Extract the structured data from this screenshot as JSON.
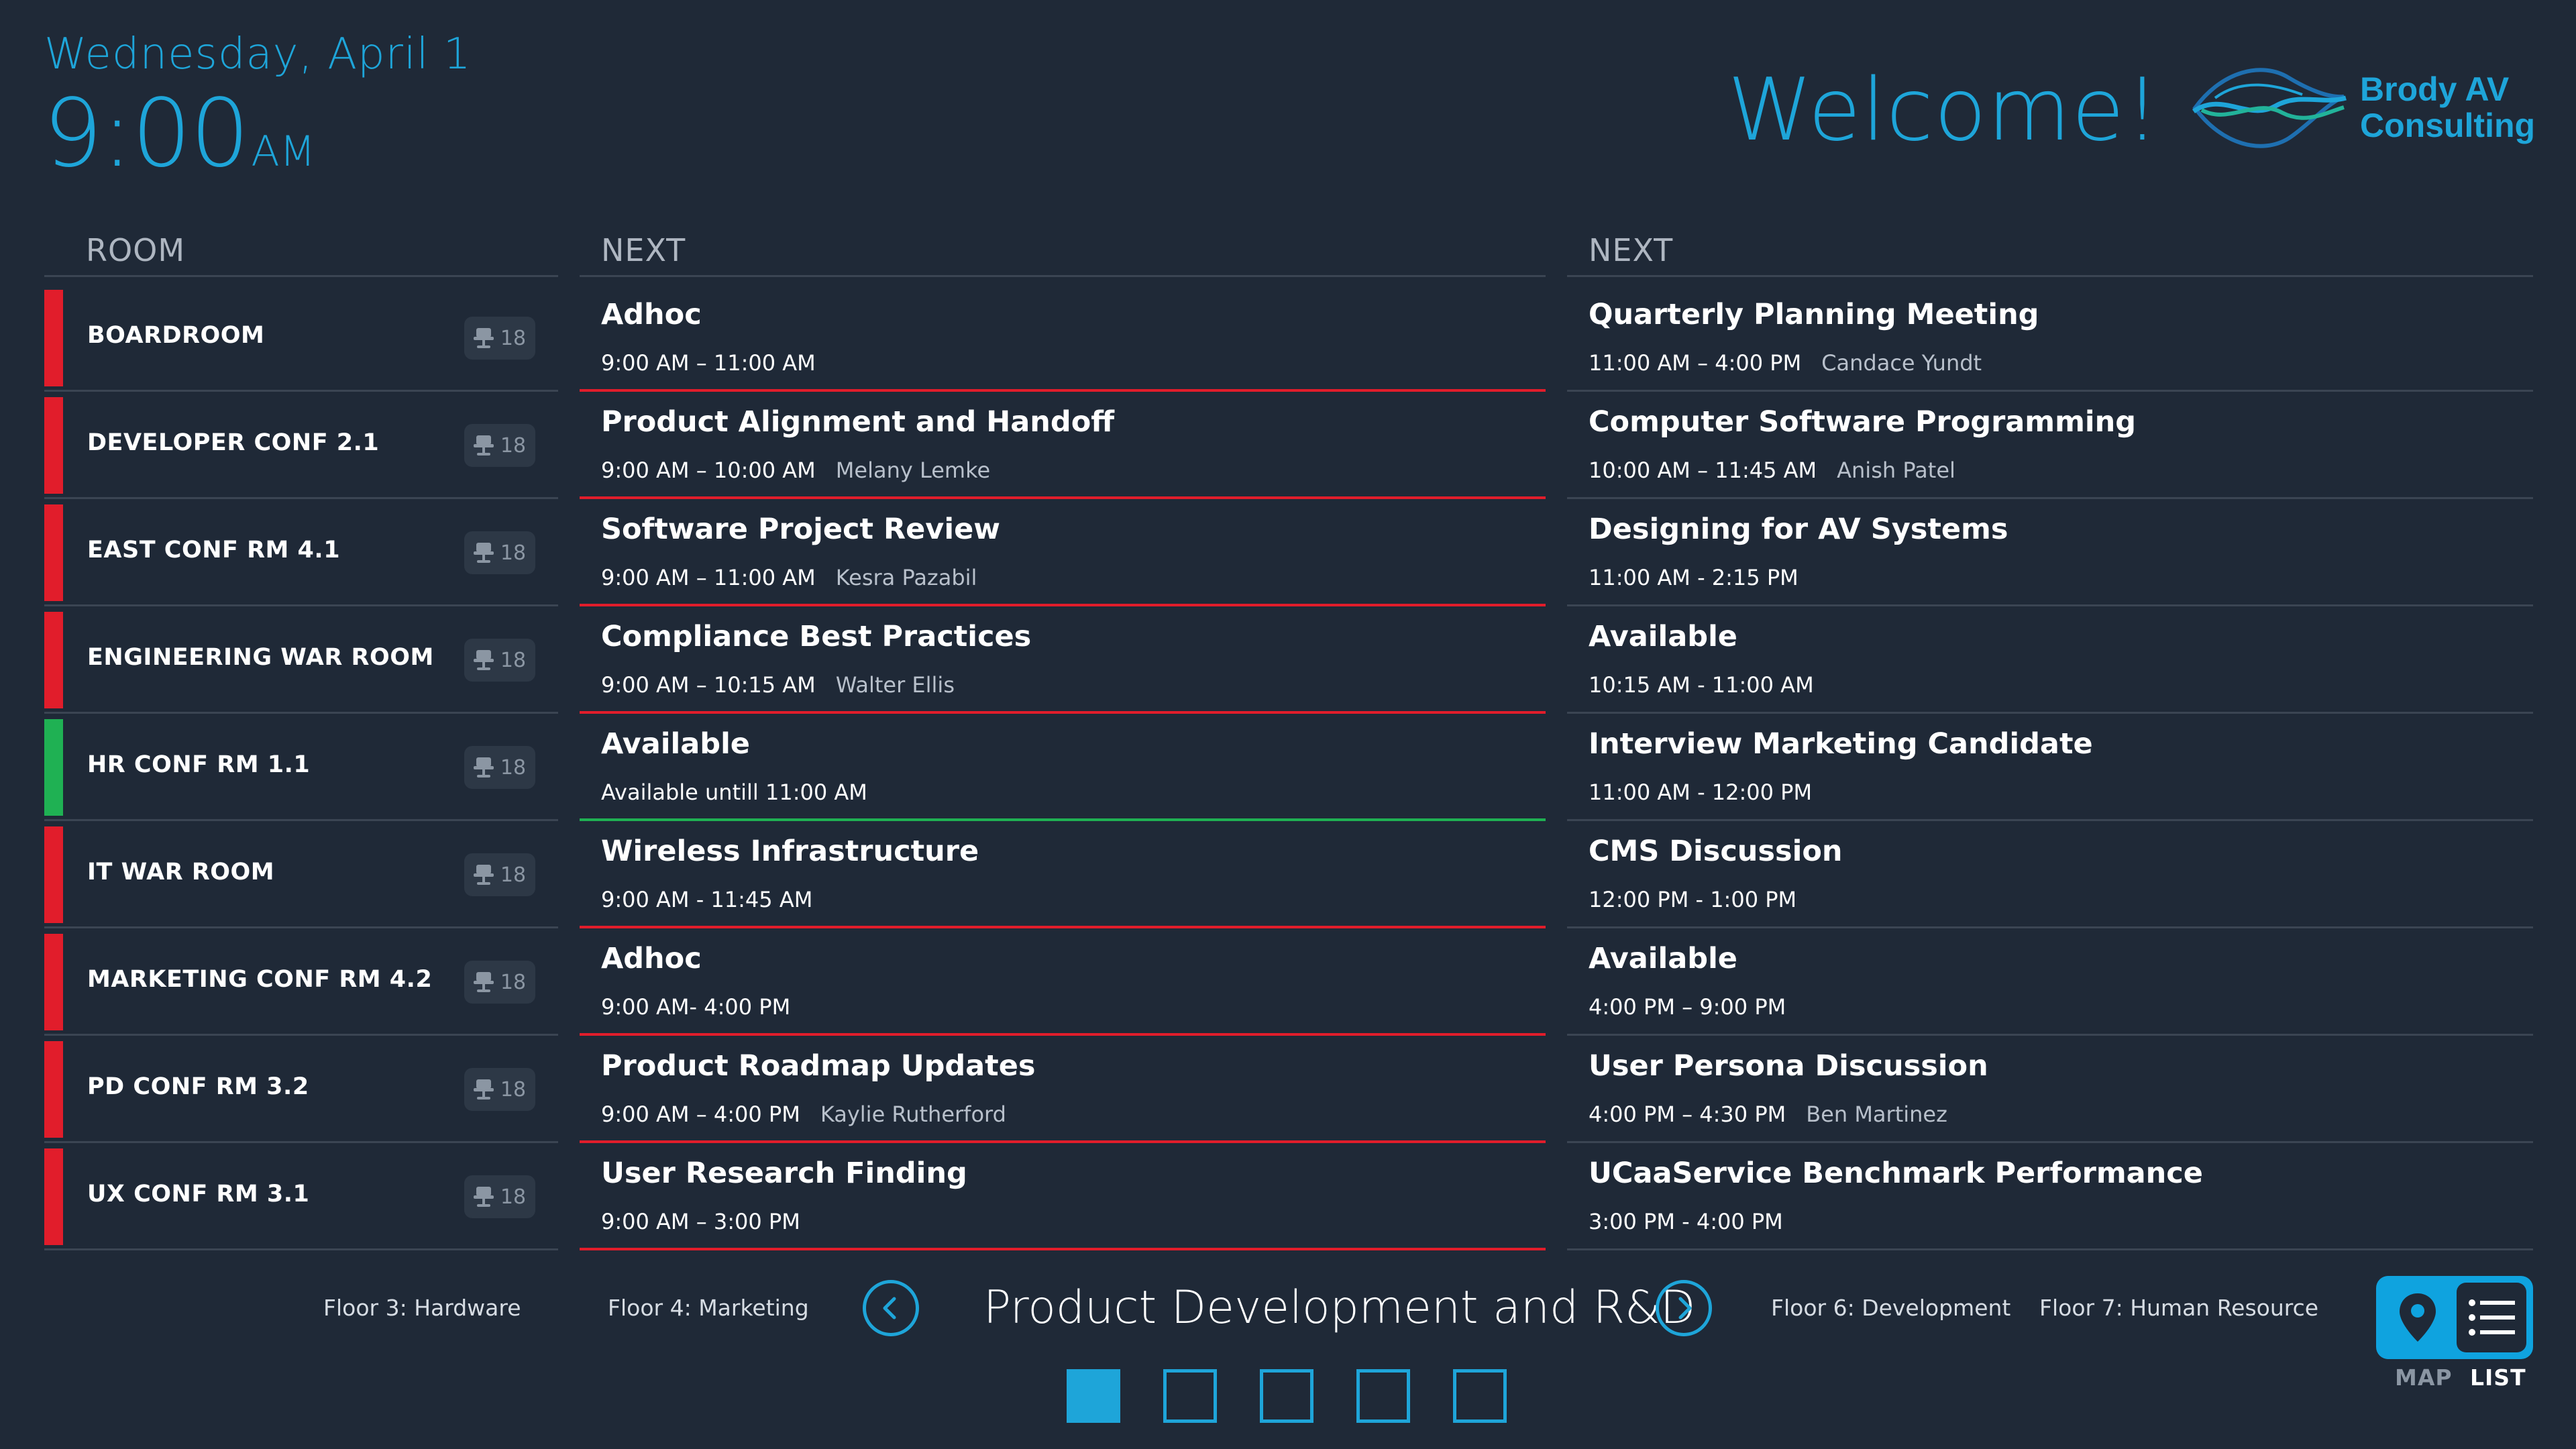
{
  "header": {
    "date": "Wednesday, April 1",
    "time": "9:00",
    "ampm": "AM",
    "welcome": "Welcome!",
    "brand_line1": "Brody AV",
    "brand_line2": "Consulting"
  },
  "columns": {
    "room": "ROOM",
    "next1": "NEXT",
    "next2": "NEXT"
  },
  "colors": {
    "accent": "#1ea5d9",
    "busy": "#e11d2b",
    "free": "#1fb153",
    "background": "#1f2937"
  },
  "rooms": [
    {
      "name": "BOARDROOM",
      "capacity": "18",
      "status": "busy"
    },
    {
      "name": "DEVELOPER CONF 2.1",
      "capacity": "18",
      "status": "busy"
    },
    {
      "name": "EAST CONF RM 4.1",
      "capacity": "18",
      "status": "busy"
    },
    {
      "name": "ENGINEERING WAR ROOM",
      "capacity": "18",
      "status": "busy"
    },
    {
      "name": "HR CONF RM 1.1",
      "capacity": "18",
      "status": "free"
    },
    {
      "name": "IT WAR ROOM",
      "capacity": "18",
      "status": "busy"
    },
    {
      "name": "MARKETING CONF RM 4.2",
      "capacity": "18",
      "status": "busy"
    },
    {
      "name": "PD CONF RM 3.2",
      "capacity": "18",
      "status": "busy"
    },
    {
      "name": "UX CONF RM 3.1",
      "capacity": "18",
      "status": "busy"
    }
  ],
  "current": [
    {
      "title": "Adhoc",
      "time": "9:00 AM – 11:00 AM",
      "who": ""
    },
    {
      "title": "Product Alignment and Handoff",
      "time": "9:00 AM – 10:00 AM",
      "who": "Melany Lemke"
    },
    {
      "title": "Software Project Review",
      "time": "9:00 AM – 11:00 AM",
      "who": "Kesra Pazabil"
    },
    {
      "title": "Compliance Best Practices",
      "time": "9:00 AM – 10:15 AM",
      "who": "Walter Ellis"
    },
    {
      "title": "Available",
      "time": "Available untill 11:00 AM",
      "who": ""
    },
    {
      "title": "Wireless Infrastructure",
      "time": "9:00 AM - 11:45 AM",
      "who": ""
    },
    {
      "title": "Adhoc",
      "time": "9:00 AM- 4:00 PM",
      "who": ""
    },
    {
      "title": "Product Roadmap Updates",
      "time": "9:00 AM – 4:00 PM",
      "who": "Kaylie Rutherford"
    },
    {
      "title": "User Research Finding",
      "time": "9:00 AM – 3:00 PM",
      "who": ""
    }
  ],
  "next": [
    {
      "title": "Quarterly Planning Meeting",
      "time": "11:00 AM – 4:00 PM",
      "who": "Candace Yundt"
    },
    {
      "title": "Computer Software Programming",
      "time": "10:00 AM – 11:45 AM",
      "who": "Anish Patel"
    },
    {
      "title": "Designing for AV Systems",
      "time": "11:00 AM - 2:15 PM",
      "who": ""
    },
    {
      "title": "Available",
      "time": "10:15 AM - 11:00 AM",
      "who": ""
    },
    {
      "title": "Interview Marketing Candidate",
      "time": "11:00 AM - 12:00 PM",
      "who": ""
    },
    {
      "title": "CMS Discussion",
      "time": "12:00 PM - 1:00 PM",
      "who": ""
    },
    {
      "title": "Available",
      "time": "4:00 PM – 9:00 PM",
      "who": ""
    },
    {
      "title": "User Persona Discussion",
      "time": "4:00 PM – 4:30 PM",
      "who": "Ben Martinez"
    },
    {
      "title": "UCaaService Benchmark Performance",
      "time": "3:00 PM - 4:00 PM",
      "who": ""
    }
  ],
  "footer": {
    "floor3": "Floor 3:  Hardware",
    "floor4": "Floor 4:  Marketing",
    "current_floor": "Product Development and R&D",
    "floor6": "Floor 6: Development",
    "floor7": "Floor 7: Human Resource",
    "pages_total": 5,
    "page_current": 1,
    "map_label": "MAP",
    "list_label": "LIST",
    "view_selected": "LIST"
  }
}
